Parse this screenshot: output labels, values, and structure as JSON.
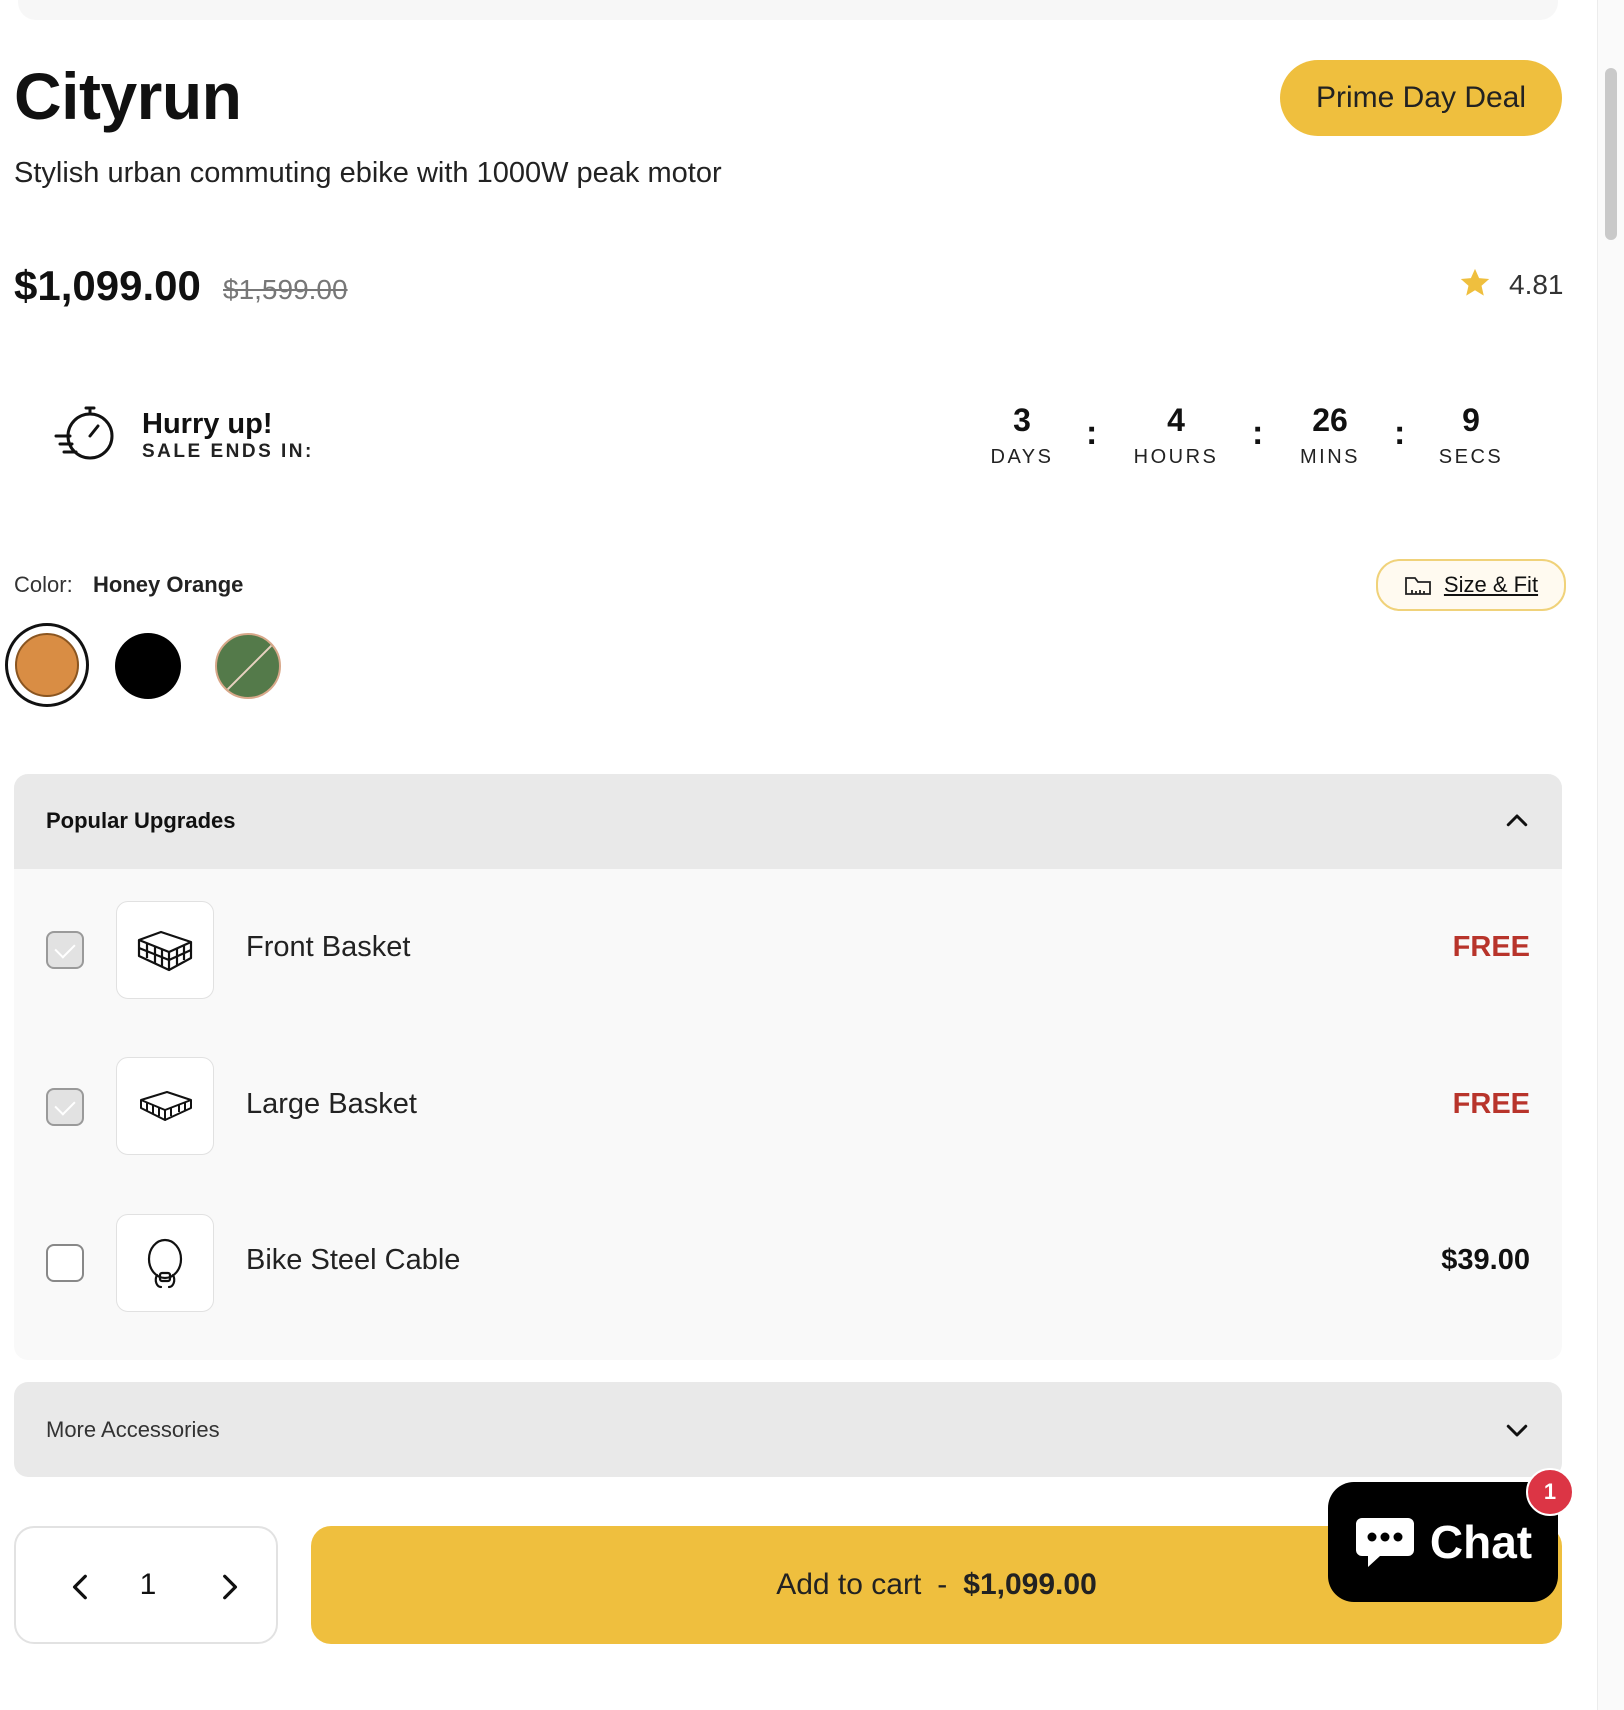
{
  "product": {
    "title": "Cityrun",
    "subtitle": "Stylish urban commuting ebike with 1000W peak motor",
    "badge": "Prime Day Deal",
    "price": "$1,099.00",
    "compare_price": "$1,599.00",
    "rating": "4.81",
    "accent_color": "#efbf3e"
  },
  "countdown": {
    "heading": "Hurry up!",
    "subheading": "SALE ENDS IN:",
    "units": [
      {
        "value": "3",
        "label": "DAYS"
      },
      {
        "value": "4",
        "label": "HOURS"
      },
      {
        "value": "26",
        "label": "MINS"
      },
      {
        "value": "9",
        "label": "SECS"
      }
    ],
    "separator": ":"
  },
  "color": {
    "label": "Color:",
    "selected": "Honey Orange",
    "swatches": [
      {
        "hex": "#d98d44",
        "selected": true
      },
      {
        "hex": "#000000",
        "selected": false
      },
      {
        "hex": "#547a4a",
        "selected": false,
        "unavailable": true
      }
    ],
    "size_fit": "Size & Fit"
  },
  "upgrades": {
    "title": "Popular Upgrades",
    "expanded": true,
    "items": [
      {
        "name": "Front Basket",
        "price": "FREE",
        "checked": true,
        "icon": "basket-icon"
      },
      {
        "name": "Large Basket",
        "price": "FREE",
        "checked": true,
        "icon": "large-basket-icon"
      },
      {
        "name": "Bike Steel Cable",
        "price": "$39.00",
        "checked": false,
        "icon": "cable-lock-icon"
      }
    ]
  },
  "accessories": {
    "title": "More Accessories",
    "expanded": false
  },
  "cart": {
    "quantity": "1",
    "button_label": "Add to cart",
    "separator": "-",
    "button_amount": "$1,099.00"
  },
  "chat": {
    "label": "Chat",
    "badge_count": "1"
  }
}
